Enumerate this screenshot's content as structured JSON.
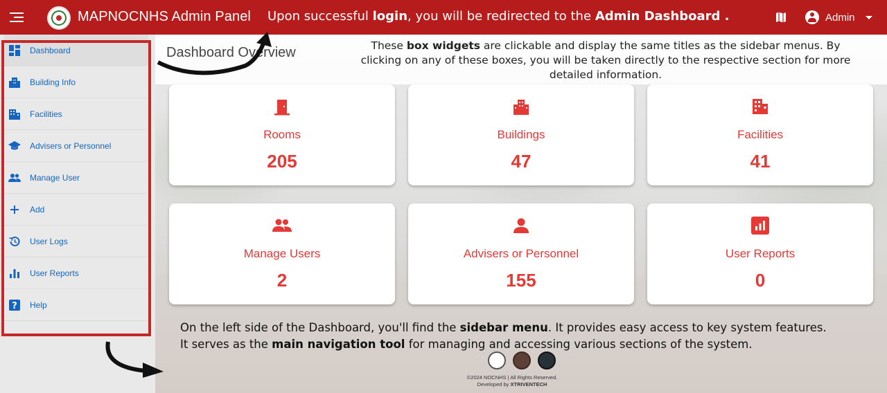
{
  "header": {
    "app_title": "MAPNOCNHS Admin Panel",
    "note_pre": "Upon successful ",
    "note_bold1": "login",
    "note_mid": ", you will be redirected to the ",
    "note_bold2": "Admin Dashboard .",
    "user_label": "Admin",
    "bg_color": "#b71c1c"
  },
  "sidebar": {
    "items": [
      {
        "label": "Dashboard",
        "icon": "dashboard-icon"
      },
      {
        "label": "Building Info",
        "icon": "building-icon"
      },
      {
        "label": "Facilities",
        "icon": "facilities-icon"
      },
      {
        "label": "Advisers or Personnel",
        "icon": "school-icon"
      },
      {
        "label": "Manage User",
        "icon": "people-icon"
      },
      {
        "label": "Add",
        "icon": "plus-icon"
      },
      {
        "label": "User Logs",
        "icon": "history-icon"
      },
      {
        "label": "User Reports",
        "icon": "bar-chart-icon"
      },
      {
        "label": "Help",
        "icon": "help-icon"
      }
    ],
    "label_color": "#1565c0",
    "highlight_color": "#c62828"
  },
  "main": {
    "page_title": "Dashboard Overview",
    "widget_note_pre": "These ",
    "widget_note_bold": "box widgets",
    "widget_note_post": " are clickable and display the same titles as the sidebar menus.   By clicking on any of these boxes, you will be taken directly to the respective section for more detailed information.",
    "cards": [
      {
        "title": "Rooms",
        "value": "205",
        "icon": "door-icon"
      },
      {
        "title": "Buildings",
        "value": "47",
        "icon": "building-icon"
      },
      {
        "title": "Facilities",
        "value": "41",
        "icon": "facilities-icon"
      },
      {
        "title": "Manage Users",
        "value": "2",
        "icon": "people-icon"
      },
      {
        "title": "Advisers or Personnel",
        "value": "155",
        "icon": "person-icon"
      },
      {
        "title": "User Reports",
        "value": "0",
        "icon": "report-icon"
      }
    ],
    "accent_color": "#e53935",
    "bottom_note_1_pre": "On the left side of the Dashboard, you'll find the ",
    "bottom_note_1_bold": "sidebar menu",
    "bottom_note_1_post": ". It provides easy access to key system features.",
    "bottom_note_2_pre": "It serves as the ",
    "bottom_note_2_bold": "main navigation tool",
    "bottom_note_2_post": " for managing and accessing various sections of the system.",
    "footer_line1": "©2024 NOCNHS | All Rights Reserved.",
    "footer_line2_pre": "Developed by ",
    "footer_line2_bold": "XTRIVENTECH"
  }
}
